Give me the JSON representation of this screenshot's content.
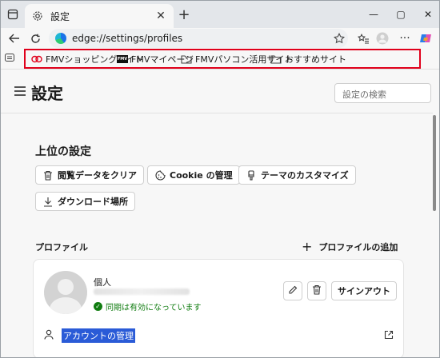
{
  "tab": {
    "title": "設定",
    "close": "✕",
    "new_tab": "+"
  },
  "window": {
    "min": "—",
    "max": "▢",
    "close": "✕"
  },
  "nav": {
    "url": "edge://settings/profiles"
  },
  "favorites": [
    {
      "label": "FMVショッピングサイト",
      "icon": "fmv-shop-icon"
    },
    {
      "label": "FMVマイページ",
      "icon": "fmv-logo-icon"
    },
    {
      "label": "FMVパソコン活用サイト",
      "icon": "folder-icon"
    },
    {
      "label": "おすすめサイト",
      "icon": "folder-icon"
    }
  ],
  "header": {
    "title": "設定",
    "search_placeholder": "設定の検索"
  },
  "top_settings": {
    "title": "上位の設定",
    "chips": [
      {
        "label": "閲覧データをクリア",
        "icon": "trash-icon"
      },
      {
        "label": "Cookie の管理",
        "icon": "cookie-icon"
      },
      {
        "label": "テーマのカスタマイズ",
        "icon": "brush-icon"
      },
      {
        "label": "ダウンロード場所",
        "icon": "download-icon"
      }
    ]
  },
  "profiles": {
    "heading": "プロファイル",
    "add_label": "プロファイルの追加",
    "card": {
      "name": "個人",
      "sync_status": "同期は有効になっています",
      "signout_label": "サインアウト",
      "account_label": "アカウントの管理"
    }
  },
  "colors": {
    "highlight": "#e0001b",
    "sync_ok": "#107c10",
    "selection": "#2a5bd7"
  }
}
